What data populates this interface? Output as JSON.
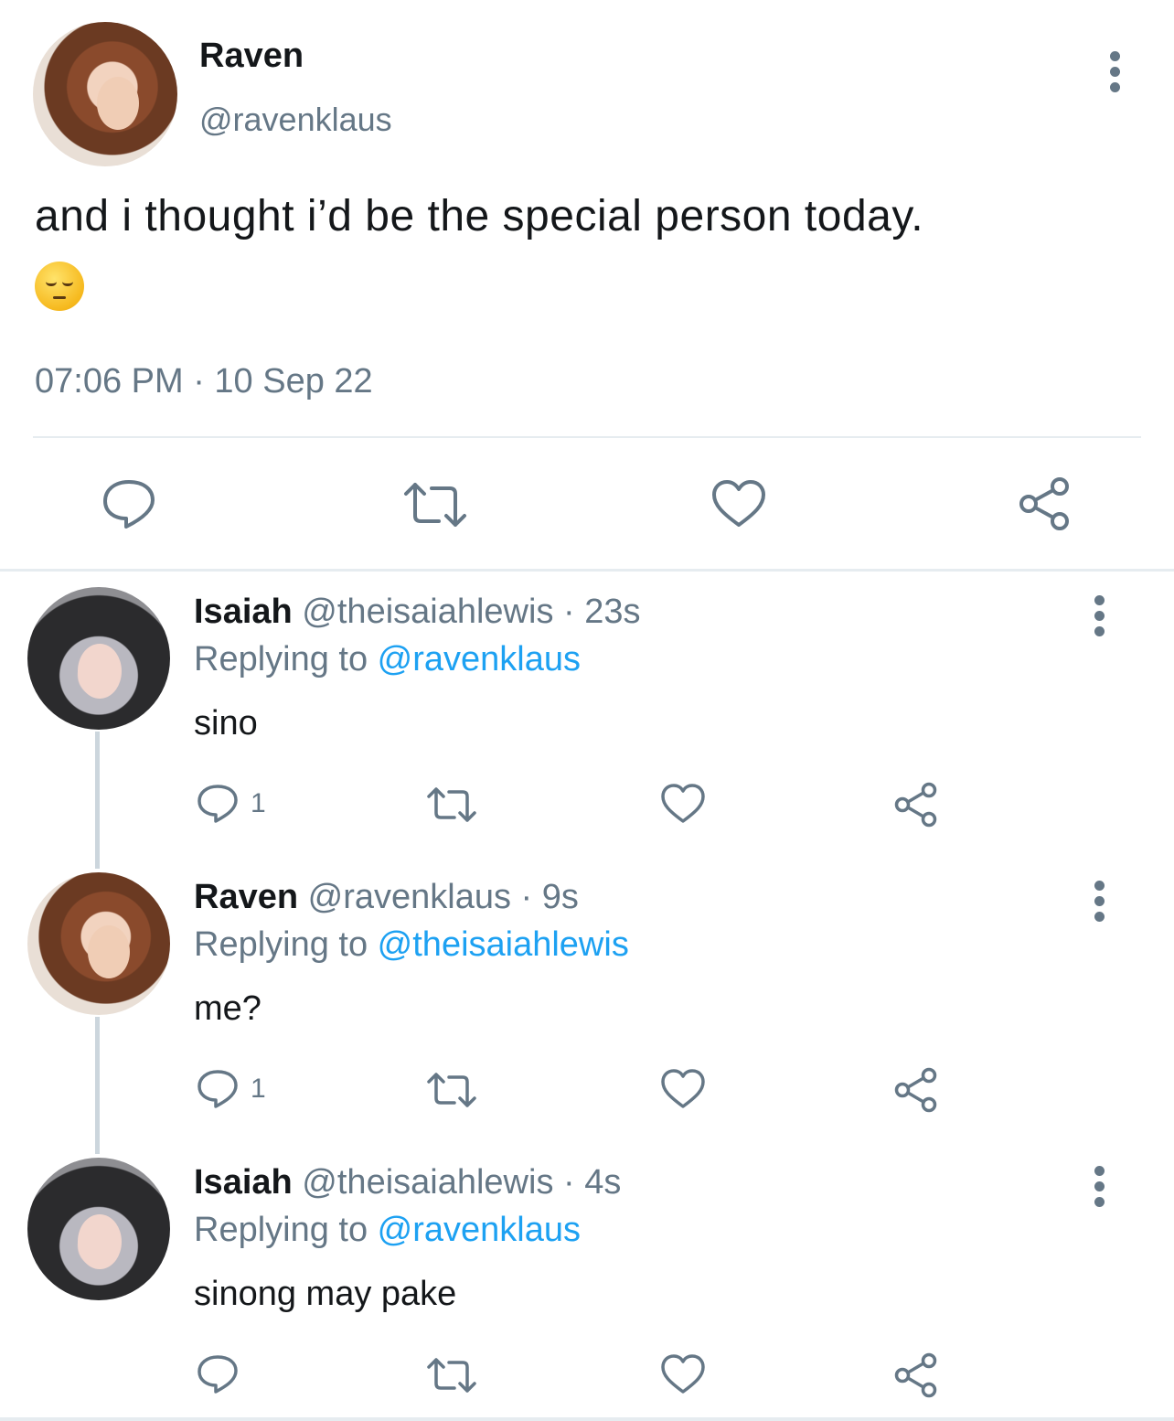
{
  "main_tweet": {
    "name": "Raven",
    "handle": "@ravenklaus",
    "text": "and i thought i’d be the special person today.",
    "emoji": "pensive-face",
    "timestamp": "07:06 PM · 10 Sep 22",
    "actions": [
      "reply-icon",
      "retweet-icon",
      "like-icon",
      "share-icon"
    ]
  },
  "replies": [
    {
      "name": "Isaiah",
      "handle": "@theisaiahlewis",
      "time": "· 23s",
      "replying_prefix": "Replying to ",
      "replying_to": "@ravenklaus",
      "text": "sino",
      "reply_count": "1"
    },
    {
      "name": "Raven",
      "handle": "@ravenklaus",
      "time": "· 9s",
      "replying_prefix": "Replying to ",
      "replying_to": "@theisaiahlewis",
      "text": "me?",
      "reply_count": "1"
    },
    {
      "name": "Isaiah",
      "handle": "@theisaiahlewis",
      "time": "· 4s",
      "replying_prefix": "Replying to ",
      "replying_to": "@ravenklaus",
      "text": "sinong may pake",
      "reply_count": ""
    }
  ],
  "colors": {
    "text": "#14171a",
    "secondary": "#657786",
    "link": "#1da1f2",
    "divider": "#e6ecf0"
  }
}
